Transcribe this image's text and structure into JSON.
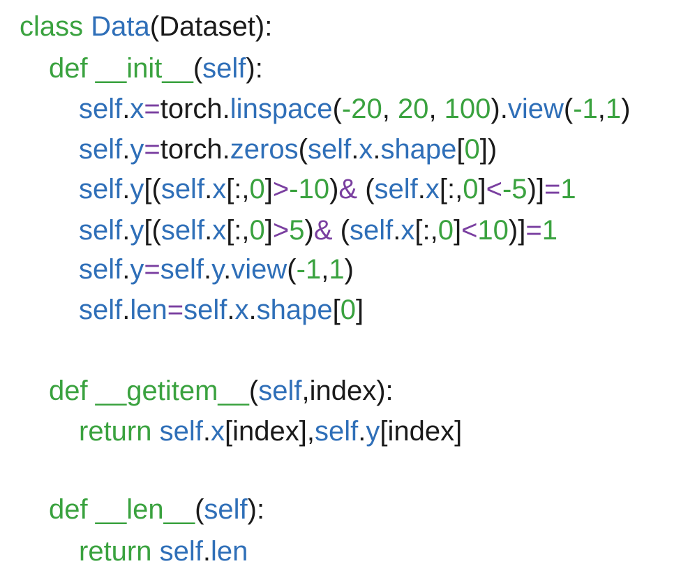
{
  "colors": {
    "green": "#3aa23f",
    "blue": "#2f6fb8",
    "black": "#1a1a1a",
    "purple": "#7a3fa0"
  },
  "lines": [
    {
      "tokens": [
        {
          "t": "class ",
          "c": "green"
        },
        {
          "t": "Data",
          "c": "blue"
        },
        {
          "t": "(Dataset):",
          "c": "black"
        }
      ]
    },
    {
      "tokens": [
        {
          "t": "def ",
          "c": "green"
        },
        {
          "t": "__init__",
          "c": "green"
        },
        {
          "t": "(",
          "c": "black"
        },
        {
          "t": "self",
          "c": "blue"
        },
        {
          "t": "):",
          "c": "black"
        }
      ]
    },
    {
      "tokens": [
        {
          "t": "self",
          "c": "blue"
        },
        {
          "t": ".",
          "c": "black"
        },
        {
          "t": "x",
          "c": "blue"
        },
        {
          "t": "=",
          "c": "purple"
        },
        {
          "t": "torch",
          "c": "black"
        },
        {
          "t": ".",
          "c": "black"
        },
        {
          "t": "linspace",
          "c": "blue"
        },
        {
          "t": "(",
          "c": "black"
        },
        {
          "t": "-20",
          "c": "green"
        },
        {
          "t": ", ",
          "c": "black"
        },
        {
          "t": "20",
          "c": "green"
        },
        {
          "t": ", ",
          "c": "black"
        },
        {
          "t": "100",
          "c": "green"
        },
        {
          "t": ").",
          "c": "black"
        },
        {
          "t": "view",
          "c": "blue"
        },
        {
          "t": "(",
          "c": "black"
        },
        {
          "t": "-1",
          "c": "green"
        },
        {
          "t": ",",
          "c": "black"
        },
        {
          "t": "1",
          "c": "green"
        },
        {
          "t": ")",
          "c": "black"
        }
      ]
    },
    {
      "tokens": [
        {
          "t": "self",
          "c": "blue"
        },
        {
          "t": ".",
          "c": "black"
        },
        {
          "t": "y",
          "c": "blue"
        },
        {
          "t": "=",
          "c": "purple"
        },
        {
          "t": "torch",
          "c": "black"
        },
        {
          "t": ".",
          "c": "black"
        },
        {
          "t": "zeros",
          "c": "blue"
        },
        {
          "t": "(",
          "c": "black"
        },
        {
          "t": "self",
          "c": "blue"
        },
        {
          "t": ".",
          "c": "black"
        },
        {
          "t": "x",
          "c": "blue"
        },
        {
          "t": ".",
          "c": "black"
        },
        {
          "t": "shape",
          "c": "blue"
        },
        {
          "t": "[",
          "c": "black"
        },
        {
          "t": "0",
          "c": "green"
        },
        {
          "t": "])",
          "c": "black"
        }
      ]
    },
    {
      "tokens": [
        {
          "t": "self",
          "c": "blue"
        },
        {
          "t": ".",
          "c": "black"
        },
        {
          "t": "y",
          "c": "blue"
        },
        {
          "t": "[(",
          "c": "black"
        },
        {
          "t": "self",
          "c": "blue"
        },
        {
          "t": ".",
          "c": "black"
        },
        {
          "t": "x",
          "c": "blue"
        },
        {
          "t": "[:,",
          "c": "black"
        },
        {
          "t": "0",
          "c": "green"
        },
        {
          "t": "]",
          "c": "black"
        },
        {
          "t": ">",
          "c": "purple"
        },
        {
          "t": "-10",
          "c": "green"
        },
        {
          "t": ")",
          "c": "black"
        },
        {
          "t": "&",
          "c": "purple"
        },
        {
          "t": " (",
          "c": "black"
        },
        {
          "t": "self",
          "c": "blue"
        },
        {
          "t": ".",
          "c": "black"
        },
        {
          "t": "x",
          "c": "blue"
        },
        {
          "t": "[:,",
          "c": "black"
        },
        {
          "t": "0",
          "c": "green"
        },
        {
          "t": "]",
          "c": "black"
        },
        {
          "t": "<",
          "c": "purple"
        },
        {
          "t": "-5",
          "c": "green"
        },
        {
          "t": ")]",
          "c": "black"
        },
        {
          "t": "=",
          "c": "purple"
        },
        {
          "t": "1",
          "c": "green"
        }
      ]
    },
    {
      "tokens": [
        {
          "t": "self",
          "c": "blue"
        },
        {
          "t": ".",
          "c": "black"
        },
        {
          "t": "y",
          "c": "blue"
        },
        {
          "t": "[(",
          "c": "black"
        },
        {
          "t": "self",
          "c": "blue"
        },
        {
          "t": ".",
          "c": "black"
        },
        {
          "t": "x",
          "c": "blue"
        },
        {
          "t": "[:,",
          "c": "black"
        },
        {
          "t": "0",
          "c": "green"
        },
        {
          "t": "]",
          "c": "black"
        },
        {
          "t": ">",
          "c": "purple"
        },
        {
          "t": "5",
          "c": "green"
        },
        {
          "t": ")",
          "c": "black"
        },
        {
          "t": "&",
          "c": "purple"
        },
        {
          "t": " (",
          "c": "black"
        },
        {
          "t": "self",
          "c": "blue"
        },
        {
          "t": ".",
          "c": "black"
        },
        {
          "t": "x",
          "c": "blue"
        },
        {
          "t": "[:,",
          "c": "black"
        },
        {
          "t": "0",
          "c": "green"
        },
        {
          "t": "]",
          "c": "black"
        },
        {
          "t": "<",
          "c": "purple"
        },
        {
          "t": "10",
          "c": "green"
        },
        {
          "t": ")]",
          "c": "black"
        },
        {
          "t": "=",
          "c": "purple"
        },
        {
          "t": "1",
          "c": "green"
        }
      ]
    },
    {
      "tokens": [
        {
          "t": "self",
          "c": "blue"
        },
        {
          "t": ".",
          "c": "black"
        },
        {
          "t": "y",
          "c": "blue"
        },
        {
          "t": "=",
          "c": "purple"
        },
        {
          "t": "self",
          "c": "blue"
        },
        {
          "t": ".",
          "c": "black"
        },
        {
          "t": "y",
          "c": "blue"
        },
        {
          "t": ".",
          "c": "black"
        },
        {
          "t": "view",
          "c": "blue"
        },
        {
          "t": "(",
          "c": "black"
        },
        {
          "t": "-1",
          "c": "green"
        },
        {
          "t": ",",
          "c": "black"
        },
        {
          "t": "1",
          "c": "green"
        },
        {
          "t": ")",
          "c": "black"
        }
      ]
    },
    {
      "tokens": [
        {
          "t": "self",
          "c": "blue"
        },
        {
          "t": ".",
          "c": "black"
        },
        {
          "t": "len",
          "c": "blue"
        },
        {
          "t": "=",
          "c": "purple"
        },
        {
          "t": "self",
          "c": "blue"
        },
        {
          "t": ".",
          "c": "black"
        },
        {
          "t": "x",
          "c": "blue"
        },
        {
          "t": ".",
          "c": "black"
        },
        {
          "t": "shape",
          "c": "blue"
        },
        {
          "t": "[",
          "c": "black"
        },
        {
          "t": "0",
          "c": "green"
        },
        {
          "t": "]",
          "c": "black"
        }
      ]
    },
    {
      "tokens": [
        {
          "t": "def ",
          "c": "green"
        },
        {
          "t": "__getitem__",
          "c": "green"
        },
        {
          "t": "(",
          "c": "black"
        },
        {
          "t": "self",
          "c": "blue"
        },
        {
          "t": ",index):",
          "c": "black"
        }
      ]
    },
    {
      "tokens": [
        {
          "t": "return ",
          "c": "green"
        },
        {
          "t": "self",
          "c": "blue"
        },
        {
          "t": ".",
          "c": "black"
        },
        {
          "t": "x",
          "c": "blue"
        },
        {
          "t": "[index],",
          "c": "black"
        },
        {
          "t": "self",
          "c": "blue"
        },
        {
          "t": ".",
          "c": "black"
        },
        {
          "t": "y",
          "c": "blue"
        },
        {
          "t": "[index]",
          "c": "black"
        }
      ]
    },
    {
      "tokens": [
        {
          "t": "def ",
          "c": "green"
        },
        {
          "t": "__len__",
          "c": "green"
        },
        {
          "t": "(",
          "c": "black"
        },
        {
          "t": "self",
          "c": "blue"
        },
        {
          "t": "):",
          "c": "black"
        }
      ]
    },
    {
      "tokens": [
        {
          "t": "return ",
          "c": "green"
        },
        {
          "t": "self",
          "c": "blue"
        },
        {
          "t": ".",
          "c": "black"
        },
        {
          "t": "len",
          "c": "blue"
        }
      ]
    }
  ]
}
